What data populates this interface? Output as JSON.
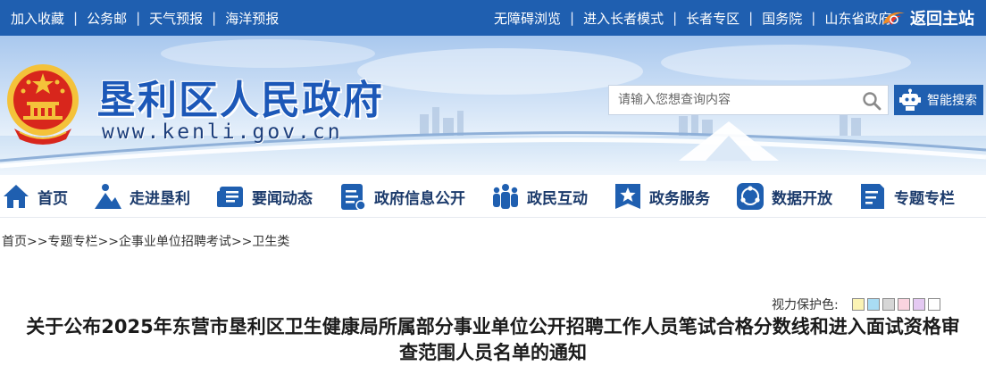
{
  "topbar": {
    "left_links": [
      "加入收藏",
      "公务邮",
      "天气预报",
      "海洋预报"
    ],
    "right_links": [
      "无障碍浏览",
      "进入长者模式",
      "长者专区",
      "国务院",
      "山东省政府"
    ],
    "return_home_label": "返回主站",
    "separator": "|"
  },
  "banner": {
    "title": "垦利区人民政府",
    "url": "www.kenli.gov.cn",
    "search_placeholder": "请输入您想查询内容",
    "ai_search_label": "智能搜索"
  },
  "nav": {
    "items": [
      {
        "label": "首页",
        "icon": "home-icon"
      },
      {
        "label": "走进垦利",
        "icon": "mountain-person-icon"
      },
      {
        "label": "要闻动态",
        "icon": "news-icon"
      },
      {
        "label": "政府信息公开",
        "icon": "document-icon"
      },
      {
        "label": "政民互动",
        "icon": "people-icon"
      },
      {
        "label": "政务服务",
        "icon": "star-badge-icon"
      },
      {
        "label": "数据开放",
        "icon": "data-share-icon"
      },
      {
        "label": "专题专栏",
        "icon": "column-doc-icon"
      }
    ]
  },
  "breadcrumb": {
    "items": [
      "首页",
      "专题专栏",
      "企事业单位招聘考试",
      "卫生类"
    ],
    "separator": ">>"
  },
  "eye_protection": {
    "label": "视力保护色:",
    "colors": [
      "#fbf3b4",
      "#a9dcf4",
      "#d6d6d6",
      "#fad4df",
      "#e4c9f2",
      "#ffffff"
    ]
  },
  "article": {
    "title": "关于公布2025年东营市垦利区卫生健康局所属部分事业单位公开招聘工作人员笔试合格分数线和进入面试资格审查范围人员名单的通知"
  },
  "colors": {
    "topbar": "#1f5fb0",
    "title_blue": "#1c58b8",
    "nav_text": "#1b3a6b",
    "icon_blue": "#1f5fb0"
  }
}
